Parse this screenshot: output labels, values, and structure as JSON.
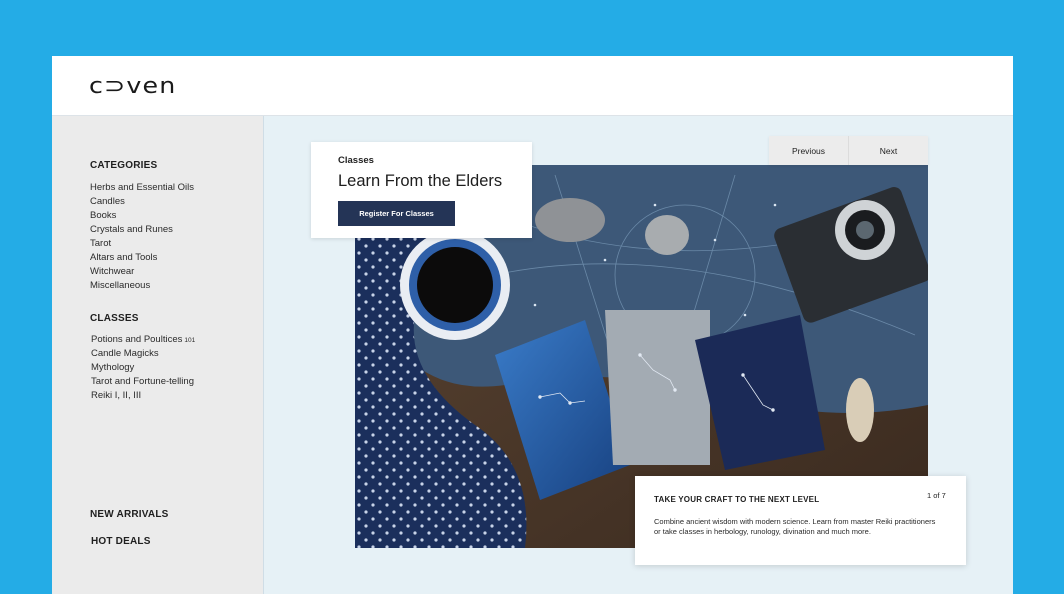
{
  "brand": {
    "logo_text": "c⊃ven"
  },
  "sidebar": {
    "categories_heading": "CATEGORIES",
    "categories": [
      "Herbs and Essential Oils",
      "Candles",
      "Books",
      "Crystals and Runes",
      "Tarot",
      "Altars and Tools",
      "Witchwear",
      "Miscellaneous"
    ],
    "classes_heading": "CLASSES",
    "classes": [
      {
        "label": "Potions and Poultices",
        "suffix": "101"
      },
      {
        "label": "Candle Magicks",
        "suffix": ""
      },
      {
        "label": "Mythology",
        "suffix": ""
      },
      {
        "label": "Tarot and Fortune-telling",
        "suffix": ""
      },
      {
        "label": "Reiki I, II, III",
        "suffix": ""
      }
    ],
    "new_arrivals": "NEW ARRIVALS",
    "hot_deals": "HOT DEALS"
  },
  "hero": {
    "eyebrow": "Classes",
    "title": "Learn From the Elders",
    "cta_label": "Register For Classes",
    "pager": {
      "previous": "Previous",
      "next": "Next"
    },
    "info": {
      "heading": "TAKE YOUR CRAFT TO THE NEXT LEVEL",
      "slide_count": "1 of 7",
      "body": "Combine ancient wisdom with modern science. Learn from master Reiki practitioners or take classes in herbology, runology, divination and much more."
    }
  },
  "colors": {
    "page_background": "#24ace6",
    "sidebar_background": "#ebebeb",
    "main_background": "#e6f1f6",
    "cta_button": "#243456"
  }
}
